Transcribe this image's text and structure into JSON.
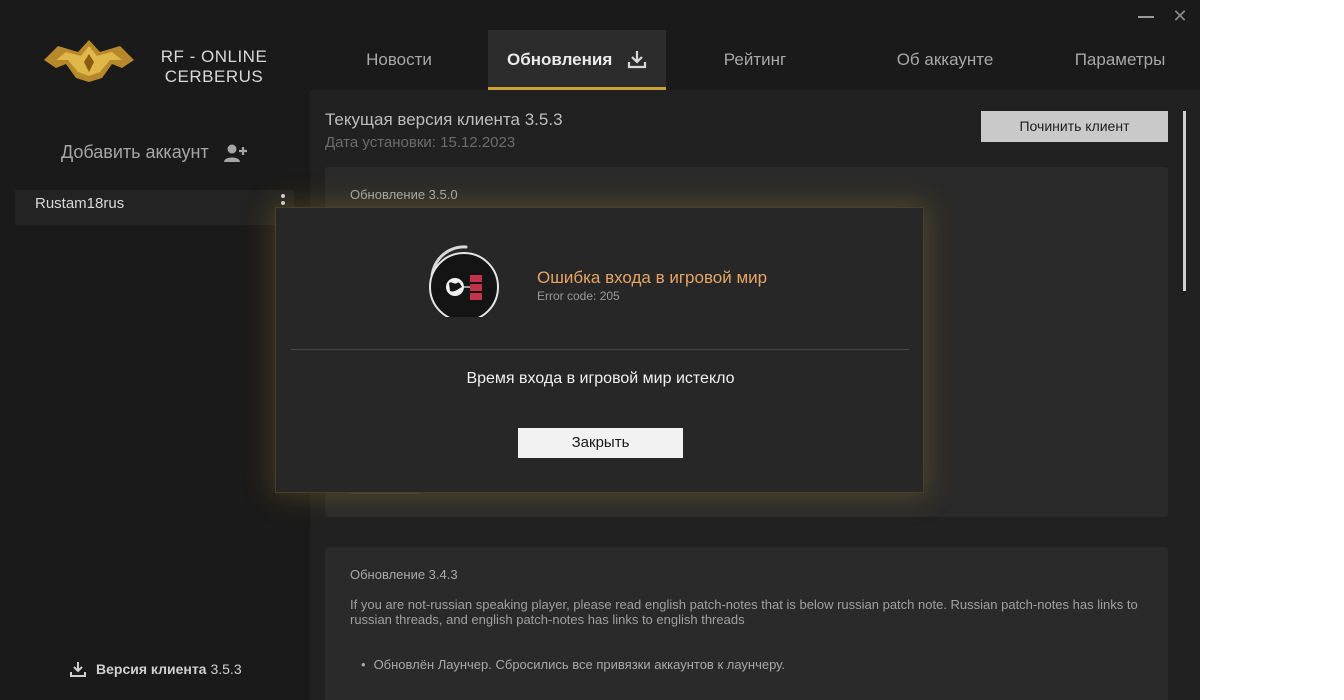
{
  "window": {
    "brand_line1": "RF - ONLINE",
    "brand_line2": "CERBERUS",
    "close_glyph": "✕"
  },
  "nav": {
    "tabs": [
      {
        "label": "Новости"
      },
      {
        "label": "Обновления"
      },
      {
        "label": "Рейтинг"
      },
      {
        "label": "Об аккаунте"
      },
      {
        "label": "Параметры"
      }
    ],
    "active_index": 1
  },
  "sidebar": {
    "add_account_label": "Добавить аккаунт",
    "accounts": [
      {
        "name": "Rustam18rus"
      }
    ],
    "client_version_label": "Версия клиента",
    "client_version_value": "3.5.3"
  },
  "main": {
    "current_version_label": "Текущая версия клиента 3.5.3",
    "install_date_label": "Дата установки: 15.12.2023",
    "repair_button_label": "Починить клиент",
    "updates": [
      {
        "title": "Обновление 3.5.0"
      },
      {
        "title": "Обновление 3.4.3",
        "text": "If you are not-russian speaking player, please read english patch-notes that is below russian patch note. Russian patch-notes has links to russian threads, and english patch-notes has links to english threads",
        "bullet": "Обновлён Лаунчер. Сбросились все привязки аккаунтов к лаунчеру."
      }
    ]
  },
  "dialog": {
    "title": "Ошибка входа в игровой мир",
    "error_code": "Error code: 205",
    "message": "Время входа в игровой мир истекло",
    "close_label": "Закрыть"
  },
  "colors": {
    "accent_gold": "#c9a03a",
    "error_orange": "#e8a466",
    "icon_red": "#c2334a"
  },
  "icons": {
    "download": "download-icon",
    "add_user": "add-user-icon",
    "kebab": "kebab-menu-icon",
    "globe_server": "globe-server-icon"
  }
}
